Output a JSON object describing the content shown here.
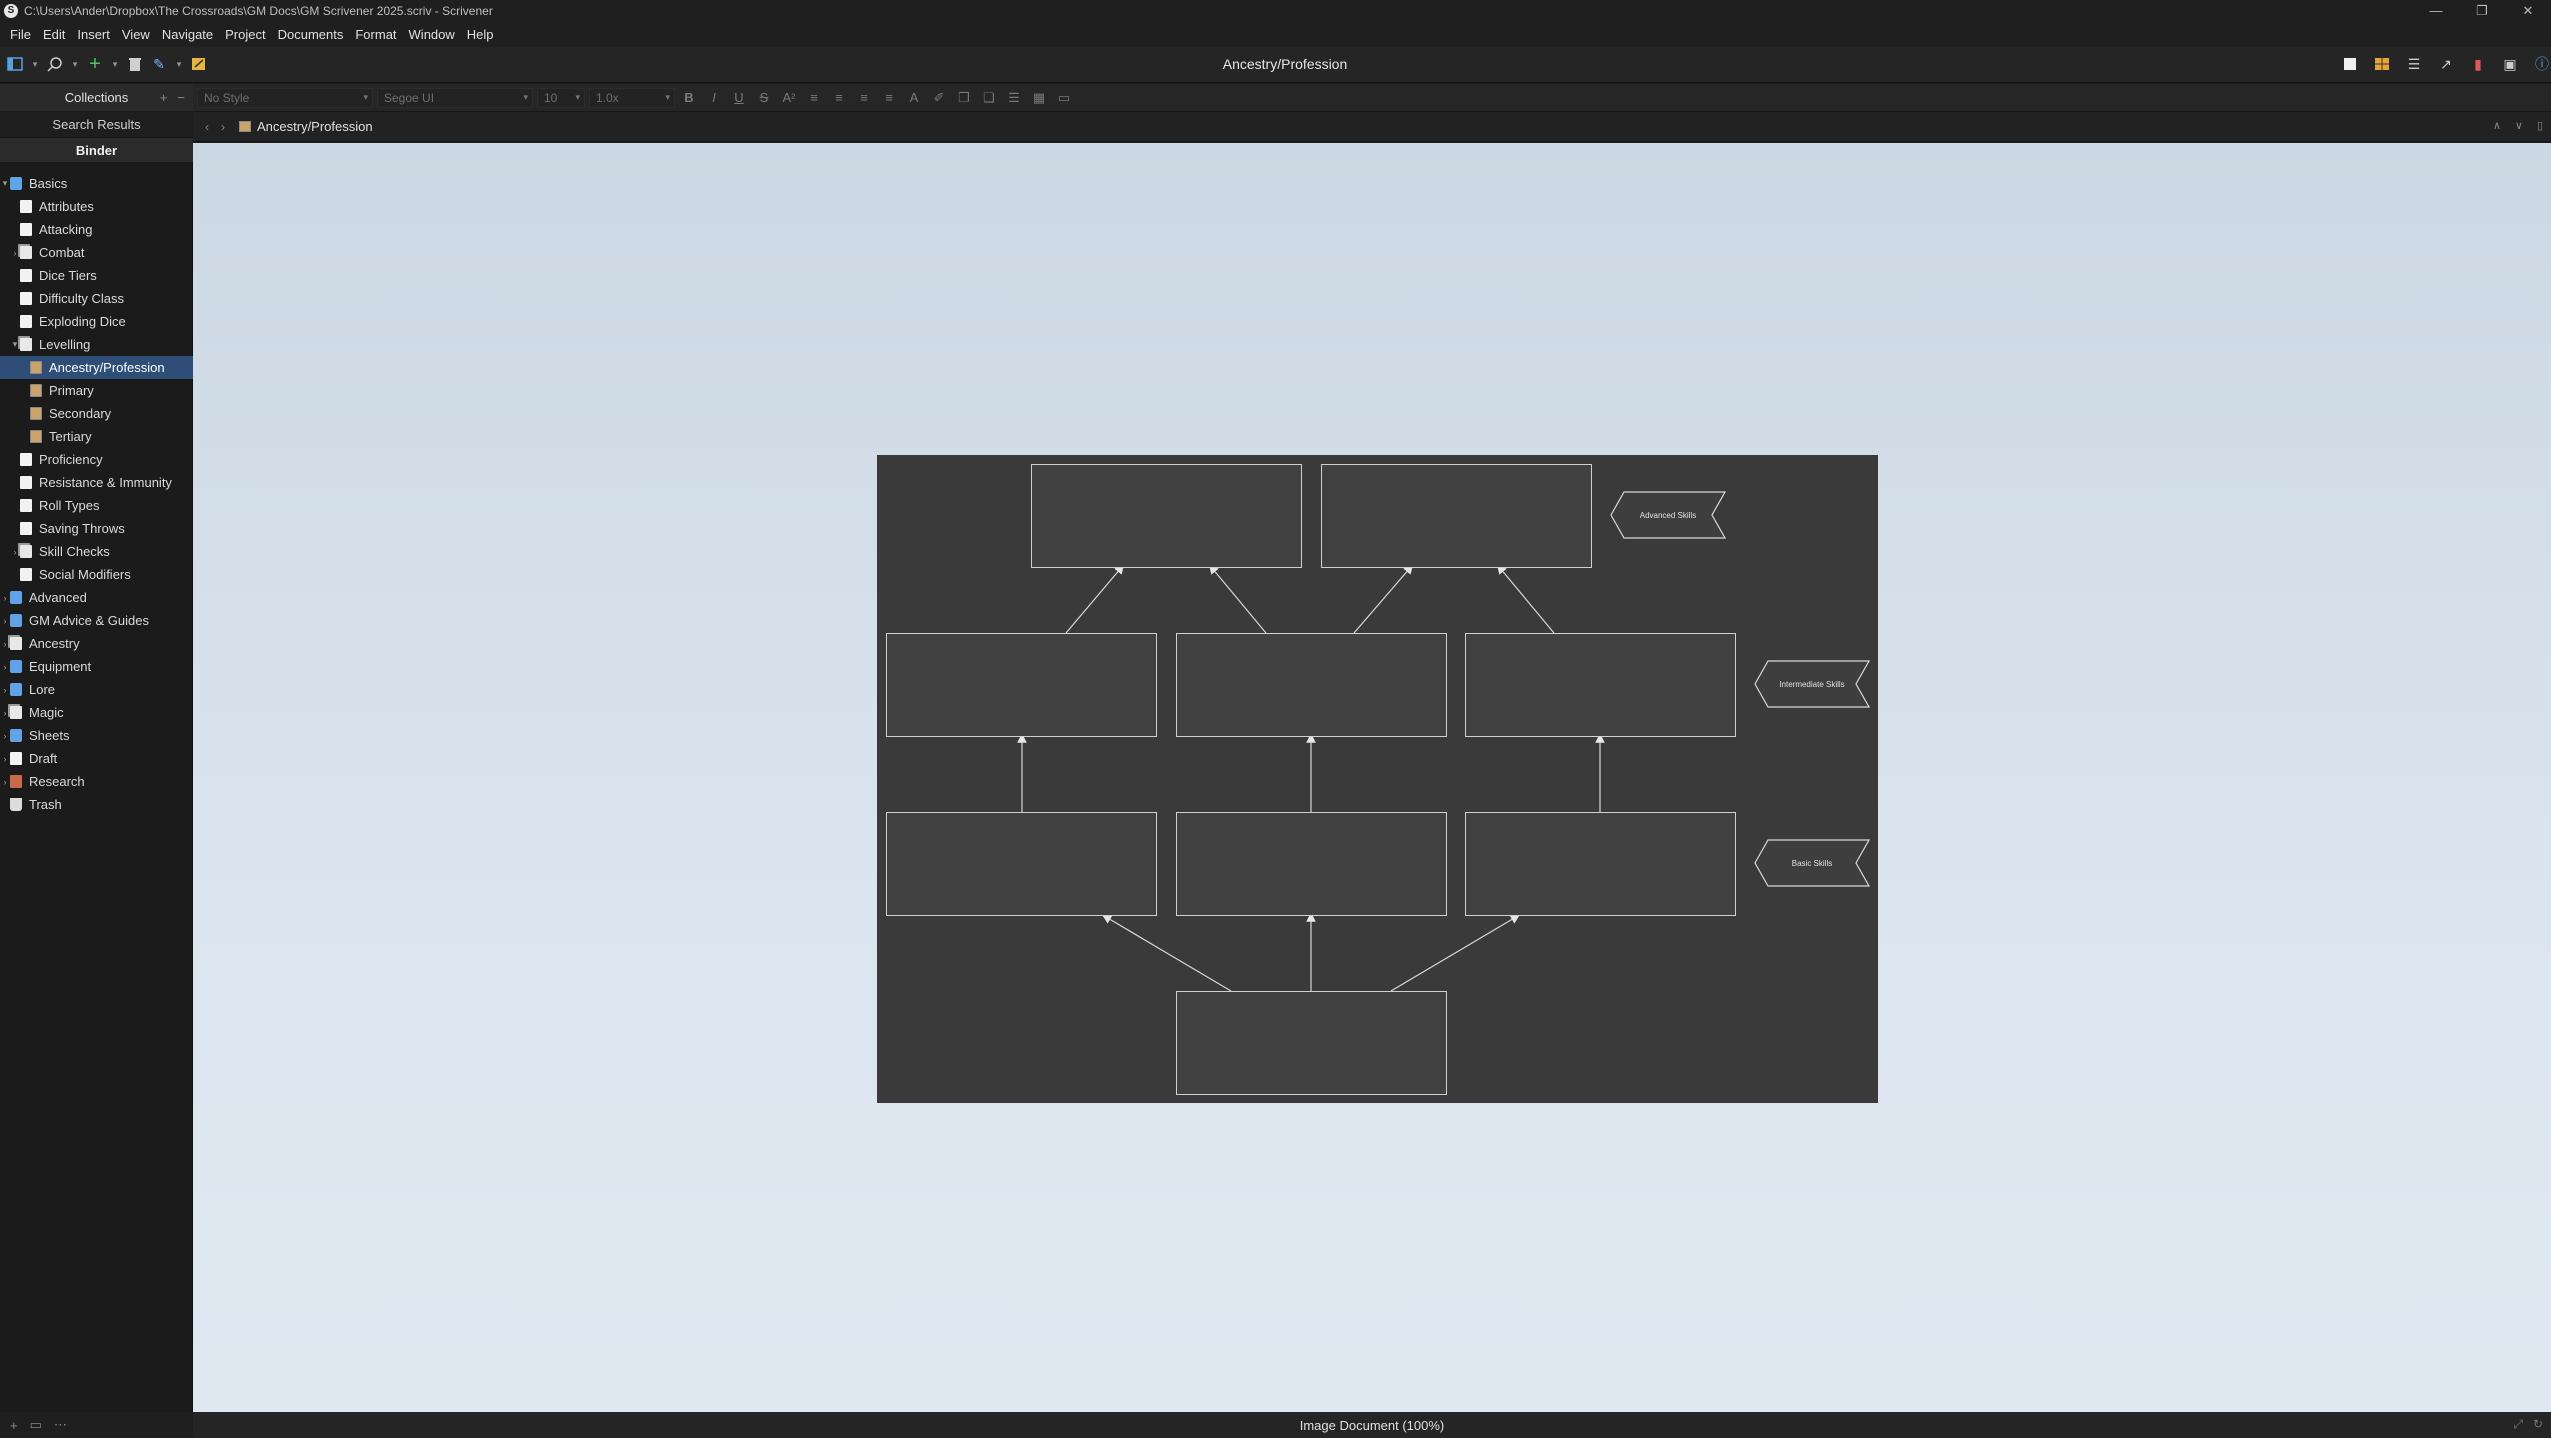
{
  "window": {
    "title": "C:\\Users\\Ander\\Dropbox\\The Crossroads\\GM Docs\\GM Scrivener 2025.scriv - Scrivener",
    "controls": [
      "—",
      "❐",
      "✕"
    ]
  },
  "menubar": [
    {
      "label": "File"
    },
    {
      "label": "Edit"
    },
    {
      "label": "Insert"
    },
    {
      "label": "View"
    },
    {
      "label": "Navigate"
    },
    {
      "label": "Project"
    },
    {
      "label": "Documents"
    },
    {
      "label": "Format"
    },
    {
      "label": "Window"
    },
    {
      "label": "Help"
    }
  ],
  "toolbar": {
    "title": "Ancestry/Profession"
  },
  "sidebar": {
    "collections_label": "Collections",
    "search_results_label": "Search Results",
    "binder_label": "Binder",
    "items": [
      {
        "label": "Basics",
        "icon": "folder-icon",
        "level": 0,
        "disclosure": "▾"
      },
      {
        "label": "Attributes",
        "icon": "document-icon",
        "level": 1,
        "disclosure": ""
      },
      {
        "label": "Attacking",
        "icon": "document-icon",
        "level": 1,
        "disclosure": ""
      },
      {
        "label": "Combat",
        "icon": "document-stack-icon",
        "level": 1,
        "disclosure": "›"
      },
      {
        "label": "Dice Tiers",
        "icon": "document-icon",
        "level": 1,
        "disclosure": ""
      },
      {
        "label": "Difficulty Class",
        "icon": "document-icon",
        "level": 1,
        "disclosure": ""
      },
      {
        "label": "Exploding Dice",
        "icon": "document-icon",
        "level": 1,
        "disclosure": ""
      },
      {
        "label": "Levelling",
        "icon": "document-stack-icon",
        "level": 1,
        "disclosure": "▾"
      },
      {
        "label": "Ancestry/Profession",
        "icon": "image-icon",
        "level": 2,
        "disclosure": "",
        "selected": true
      },
      {
        "label": "Primary",
        "icon": "image-icon",
        "level": 2,
        "disclosure": ""
      },
      {
        "label": "Secondary",
        "icon": "image-icon",
        "level": 2,
        "disclosure": ""
      },
      {
        "label": "Tertiary",
        "icon": "image-icon",
        "level": 2,
        "disclosure": ""
      },
      {
        "label": "Proficiency",
        "icon": "document-icon",
        "level": 1,
        "disclosure": ""
      },
      {
        "label": "Resistance & Immunity",
        "icon": "document-icon",
        "level": 1,
        "disclosure": ""
      },
      {
        "label": "Roll Types",
        "icon": "document-icon",
        "level": 1,
        "disclosure": ""
      },
      {
        "label": "Saving Throws",
        "icon": "document-icon",
        "level": 1,
        "disclosure": ""
      },
      {
        "label": "Skill Checks",
        "icon": "document-stack-icon",
        "level": 1,
        "disclosure": "›"
      },
      {
        "label": "Social Modifiers",
        "icon": "document-icon",
        "level": 1,
        "disclosure": ""
      },
      {
        "label": "Advanced",
        "icon": "folder-icon",
        "level": 0,
        "disclosure": "›"
      },
      {
        "label": "GM Advice & Guides",
        "icon": "folder-icon",
        "level": 0,
        "disclosure": "›"
      },
      {
        "label": "Ancestry",
        "icon": "document-stack-icon",
        "level": 0,
        "disclosure": "›"
      },
      {
        "label": "Equipment",
        "icon": "folder-icon",
        "level": 0,
        "disclosure": "›"
      },
      {
        "label": "Lore",
        "icon": "folder-icon",
        "level": 0,
        "disclosure": "›"
      },
      {
        "label": "Magic",
        "icon": "document-stack-icon",
        "level": 0,
        "disclosure": "›"
      },
      {
        "label": "Sheets",
        "icon": "folder-icon",
        "level": 0,
        "disclosure": "›"
      },
      {
        "label": "Draft",
        "icon": "document-icon",
        "level": 0,
        "disclosure": "›"
      },
      {
        "label": "Research",
        "icon": "research-icon",
        "level": 0,
        "disclosure": "›"
      },
      {
        "label": "Trash",
        "icon": "trash-icon",
        "level": 0,
        "disclosure": ""
      }
    ]
  },
  "formatbar": {
    "style": "No Style",
    "font": "Segoe UI",
    "size": "10",
    "line_spacing": "1.0x"
  },
  "header": {
    "title": "Ancestry/Profession"
  },
  "diagram": {
    "tags": [
      "Advanced Skills",
      "Intermediate Skills",
      "Basic Skills"
    ]
  },
  "status": {
    "text": "Image Document (100%)"
  }
}
